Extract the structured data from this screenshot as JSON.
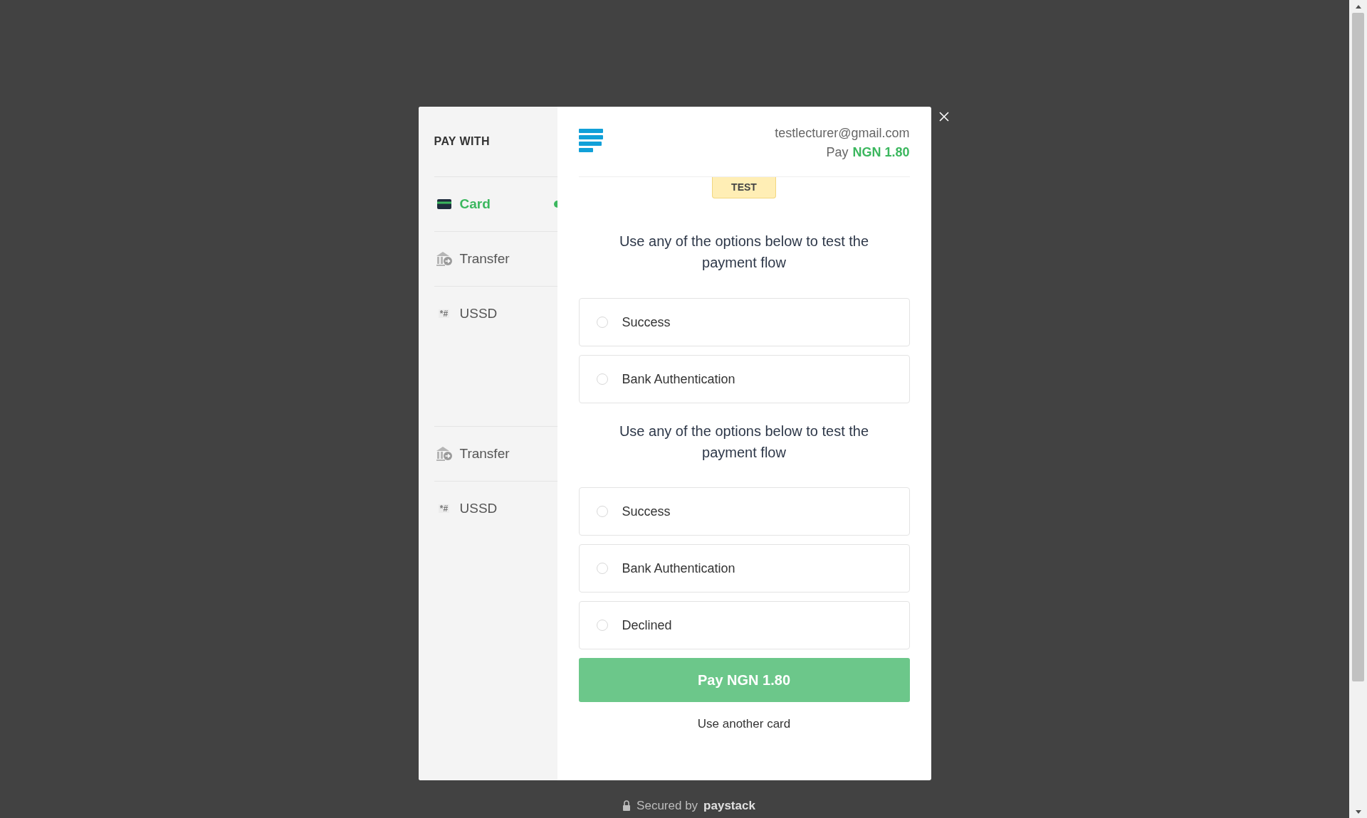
{
  "sidebar": {
    "title": "PAY WITH",
    "groups": [
      {
        "items": [
          {
            "kind": "card",
            "label": "Card",
            "selected": true
          },
          {
            "kind": "bank",
            "label": "Transfer",
            "selected": false
          },
          {
            "kind": "ussd",
            "glyph": "*#",
            "label": "USSD",
            "selected": false
          }
        ]
      },
      {
        "items": [
          {
            "kind": "bank",
            "label": "Transfer",
            "selected": false
          },
          {
            "kind": "ussd",
            "glyph": "*#",
            "label": "USSD",
            "selected": false
          }
        ]
      }
    ]
  },
  "header": {
    "email": "testlecturer@gmail.com",
    "pay_label": "Pay",
    "amount": "NGN 1.80"
  },
  "badge": "TEST",
  "sections": [
    {
      "heading": "Use any of the options below to test the payment flow",
      "options": [
        {
          "label": "Success",
          "selected": false
        },
        {
          "label": "Bank Authentication",
          "selected": false
        }
      ]
    },
    {
      "heading": "Use any of the options below to test the payment flow",
      "options": [
        {
          "label": "Success",
          "selected": false
        },
        {
          "label": "Bank Authentication",
          "selected": false
        },
        {
          "label": "Declined",
          "selected": false
        }
      ]
    }
  ],
  "pay_button": "Pay NGN 1.80",
  "secondary_link": "Use another card",
  "footer": {
    "text": "Secured by",
    "brand": "paystack"
  }
}
